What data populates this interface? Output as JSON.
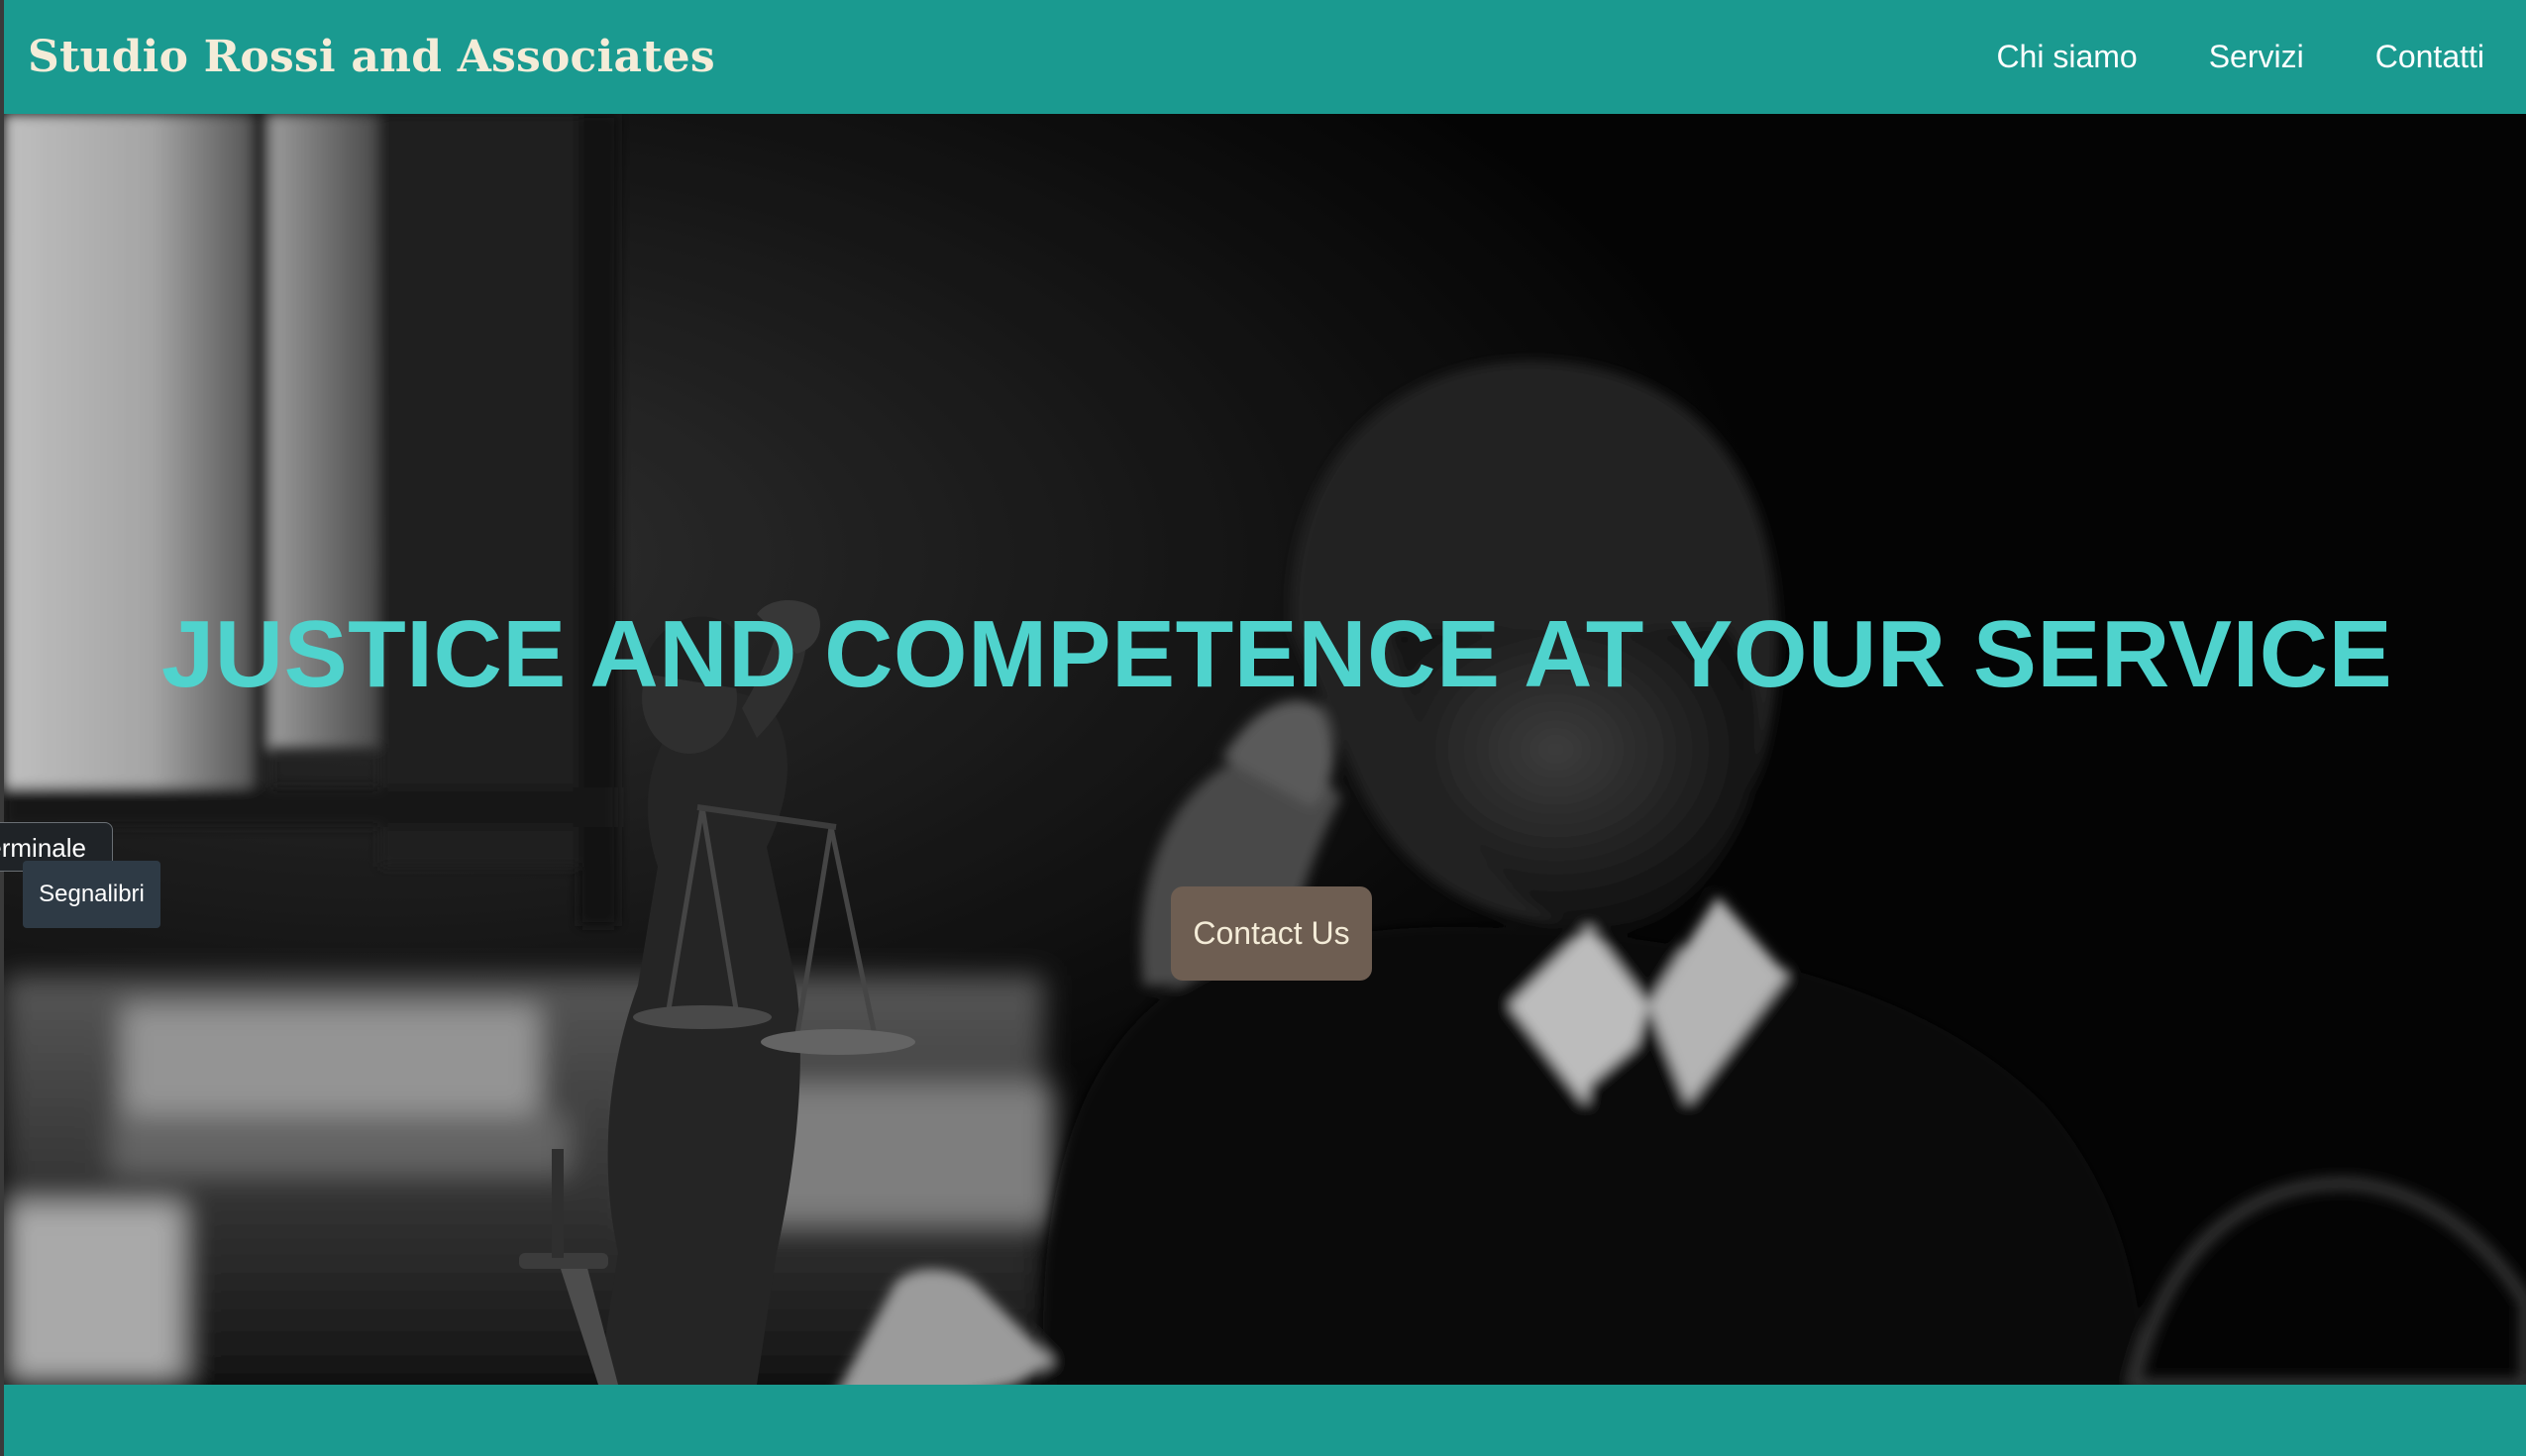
{
  "header": {
    "brand": "Studio Rossi and Associates",
    "nav": [
      {
        "label": "Chi siamo"
      },
      {
        "label": "Servizi"
      },
      {
        "label": "Contatti"
      }
    ]
  },
  "hero": {
    "title": "JUSTICE AND COMPETENCE AT YOUR SERVICE",
    "cta_label": "Contact Us",
    "image_icon": "lawyer-with-lady-justice-statue-photo"
  },
  "tooltips": {
    "terminal": "Terminale",
    "bookmarks": "Segnalibri"
  },
  "colors": {
    "header_bg": "#1a9a90",
    "brand_text": "#f4ecd8",
    "hero_title": "#4fd3cd",
    "cta_bg": "#6e5e52",
    "footer_bg": "#1a9a90"
  }
}
